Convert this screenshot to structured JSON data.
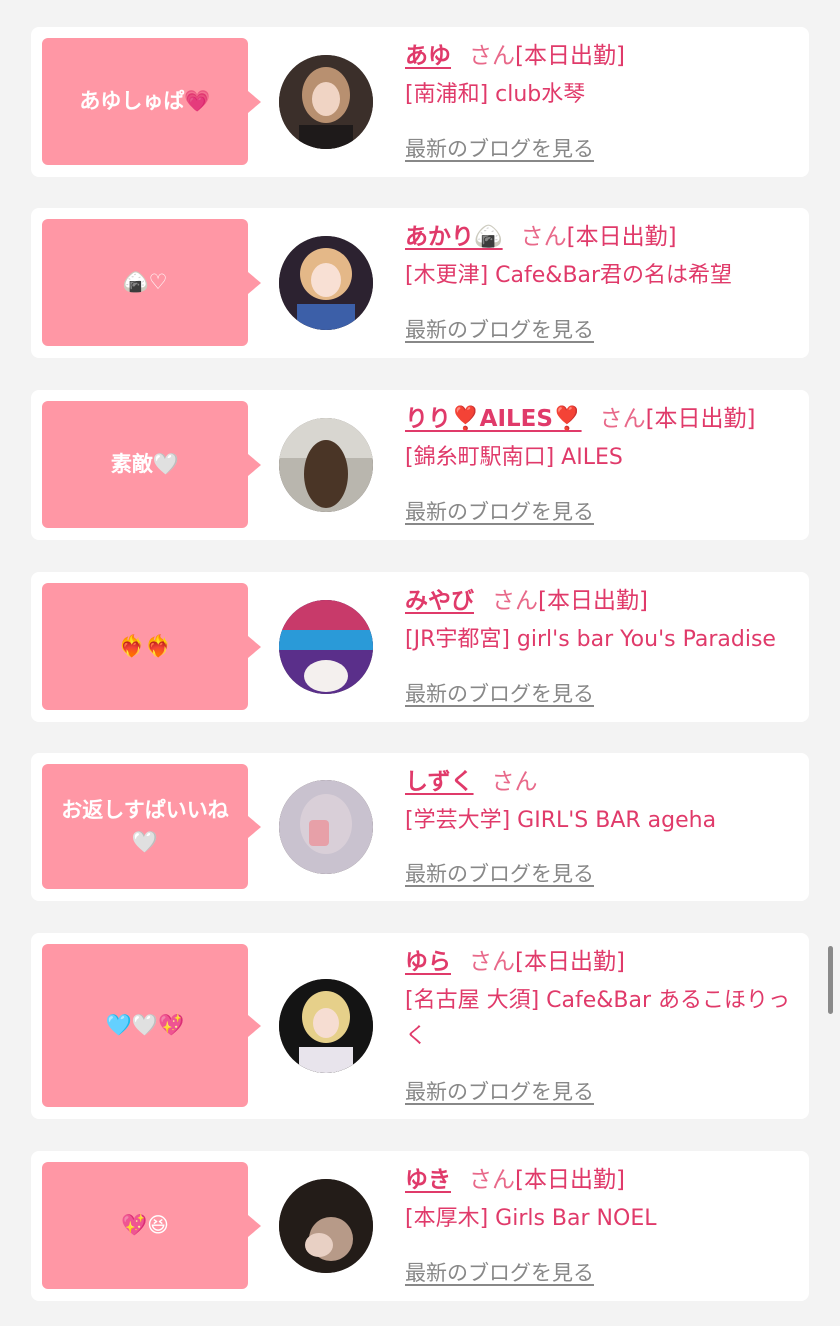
{
  "cards": [
    {
      "comment": "あゆしゅぱ💗",
      "name": "あゆ",
      "honorific": "さん",
      "status": "[本日出勤]",
      "shop": "[南浦和] club水琴",
      "blog_link": "最新のブログを見る"
    },
    {
      "comment": "🍙♡",
      "name": "あかり🍙",
      "honorific": "さん",
      "status": "[本日出勤]",
      "shop": "[木更津] Cafe&Bar君の名は希望",
      "blog_link": "最新のブログを見る"
    },
    {
      "comment": "素敵🤍",
      "name": "りり❣️AILES❣️",
      "honorific": "さん",
      "status": "[本日出勤]",
      "shop": "[錦糸町駅南口] AILES",
      "blog_link": "最新のブログを見る"
    },
    {
      "comment": "❤️‍🔥❤️‍🔥",
      "name": "みやび",
      "honorific": "さん",
      "status": "[本日出勤]",
      "shop": "[JR宇都宮] girl's bar You's Paradise",
      "blog_link": "最新のブログを見る"
    },
    {
      "comment": "お返しすぱいいね🤍",
      "name": "しずく",
      "honorific": "さん",
      "status": "",
      "shop": "[学芸大学] GIRL'S BAR ageha",
      "blog_link": "最新のブログを見る"
    },
    {
      "comment": "🩵🤍💖",
      "name": "ゆら",
      "honorific": "さん",
      "status": "[本日出勤]",
      "shop": "[名古屋 大須] Cafe&Bar あるこほりっく",
      "blog_link": "最新のブログを見る"
    },
    {
      "comment": "💖😆",
      "name": "ゆき",
      "honorific": "さん",
      "status": "[本日出勤]",
      "shop": "[本厚木] Girls Bar NOEL",
      "blog_link": "最新のブログを見る"
    }
  ],
  "colors": {
    "accent": "#e03a6a",
    "bubble": "#ff97a5",
    "background": "#f3f3f3",
    "card": "#ffffff"
  }
}
